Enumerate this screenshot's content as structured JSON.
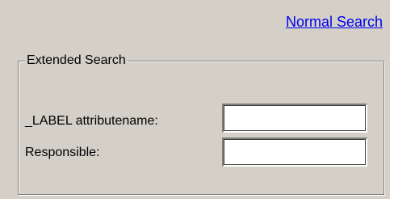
{
  "header": {
    "normal_search_link": "Normal Search"
  },
  "extended_search": {
    "legend": "Extended Search",
    "fields": [
      {
        "label": "_LABEL attributename:",
        "value": "",
        "placeholder": ""
      },
      {
        "label": "Responsible:",
        "value": "",
        "placeholder": ""
      }
    ]
  },
  "colors": {
    "panel_background": "#d4d0c8",
    "link": "#0000ee",
    "page_background": "#ffffff"
  }
}
